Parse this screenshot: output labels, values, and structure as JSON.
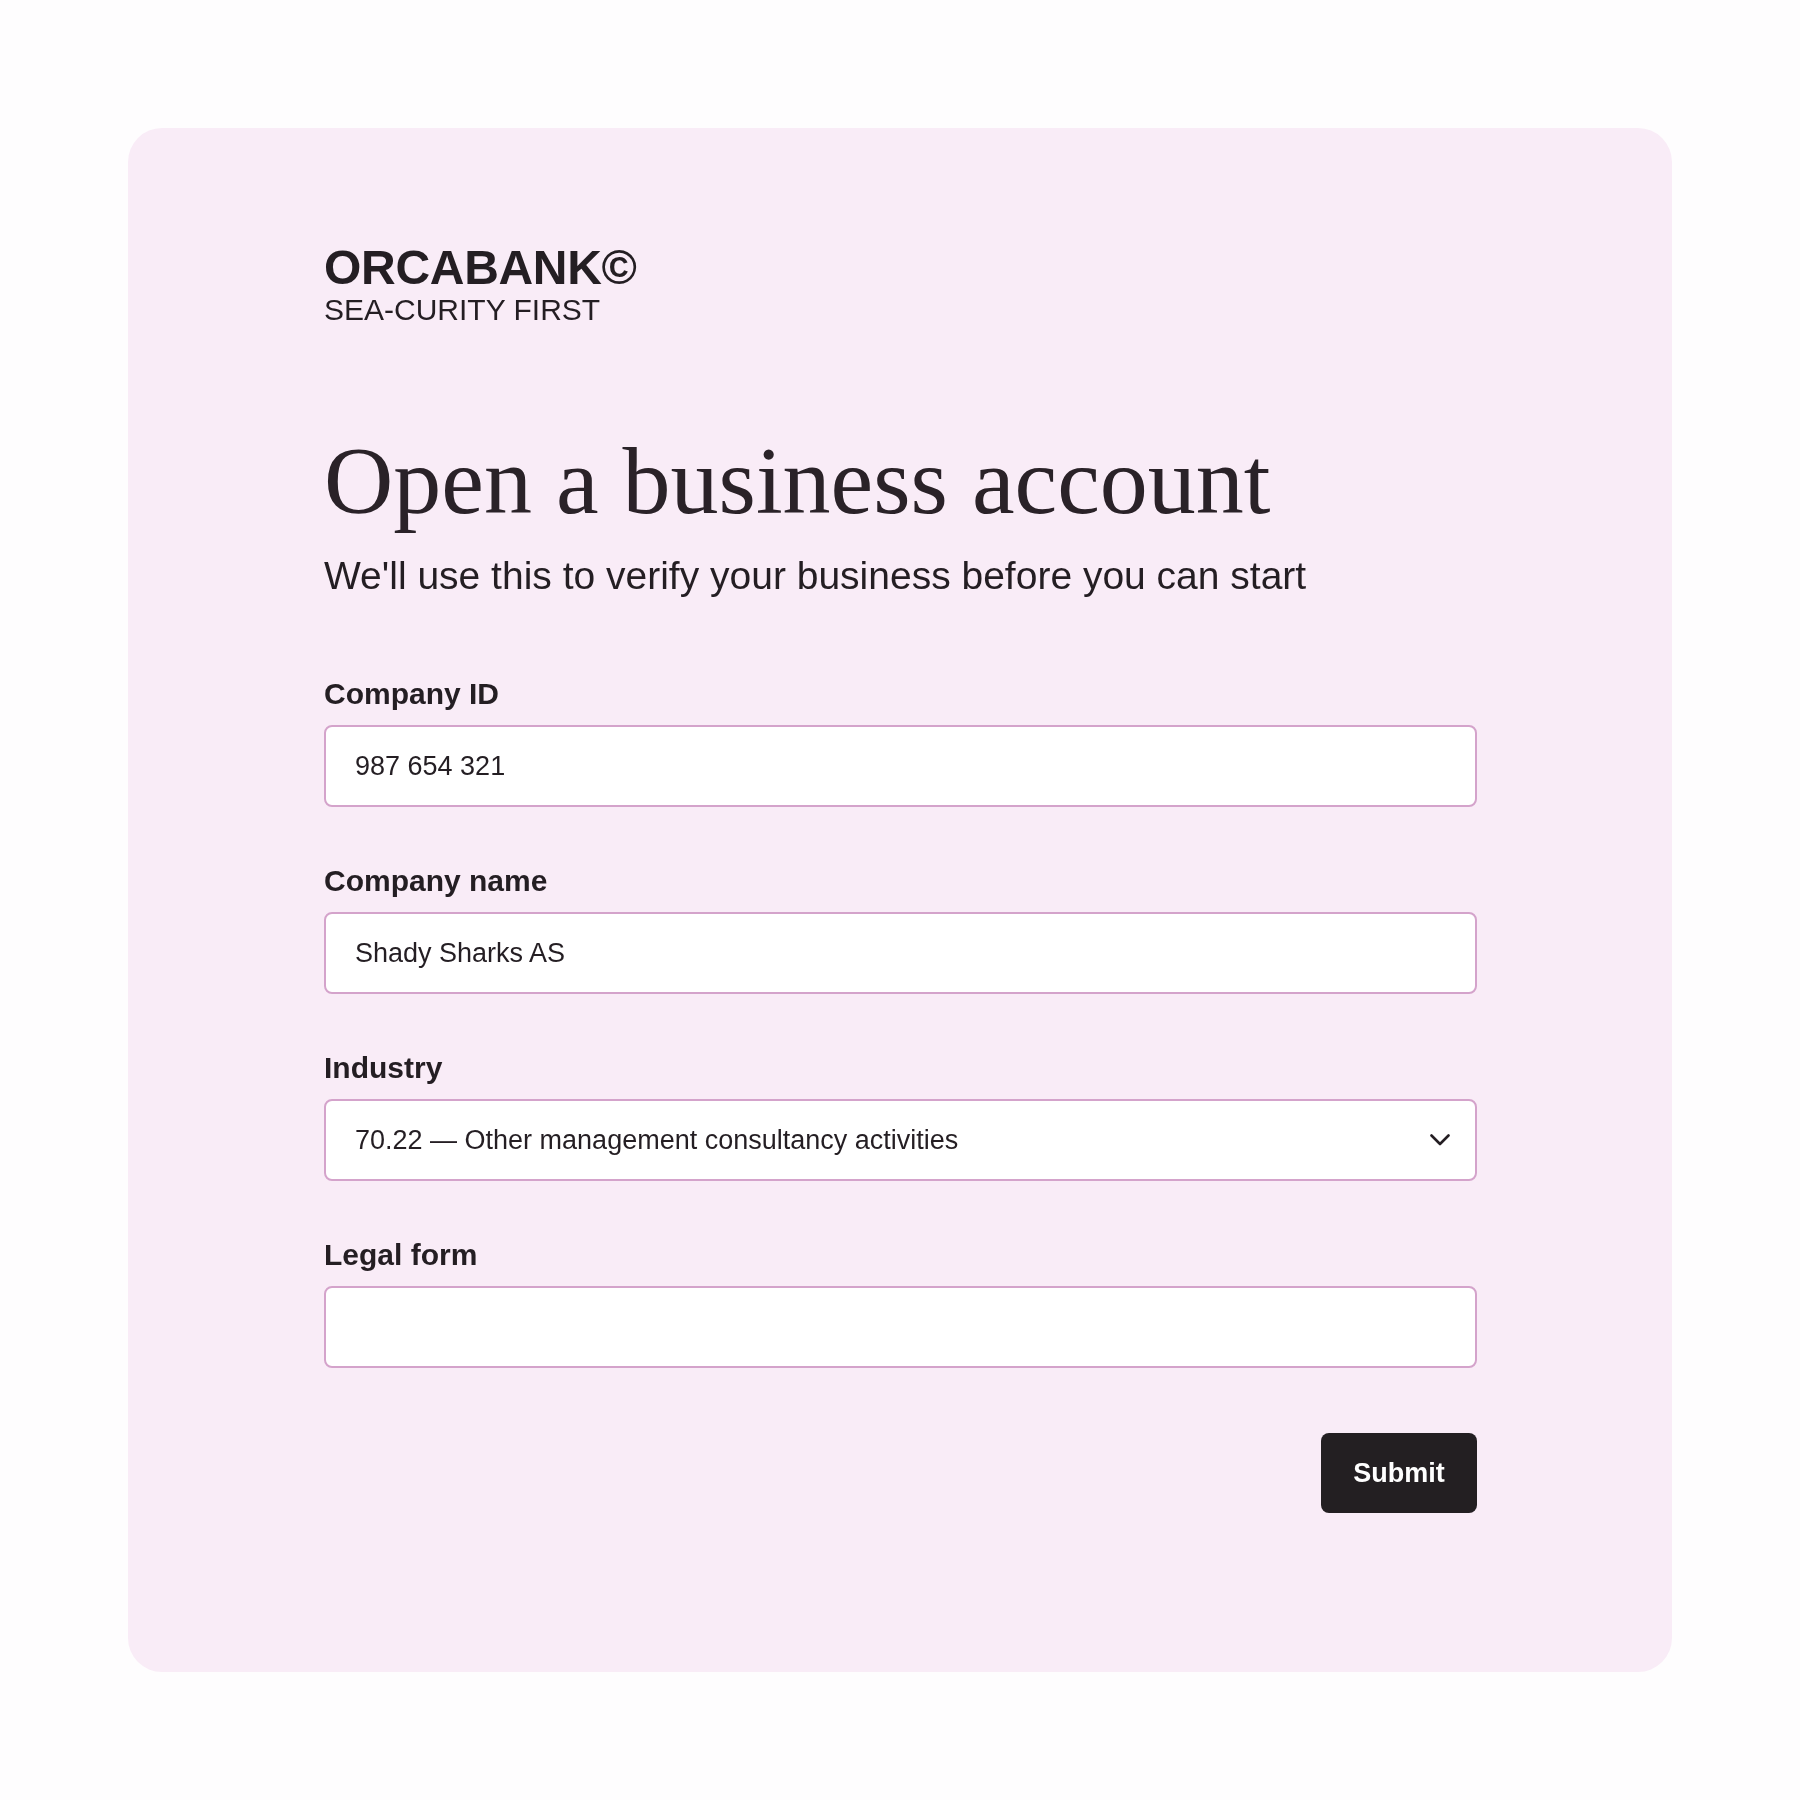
{
  "brand": {
    "name": "ORCABANK©",
    "tagline": "SEA-CURITY FIRST"
  },
  "heading": {
    "title": "Open a business account",
    "subtitle": "We'll use this to verify your business before you can start"
  },
  "fields": [
    {
      "label": "Company ID",
      "kind": "text",
      "value": "987 654 321"
    },
    {
      "label": "Company name",
      "kind": "text",
      "value": "Shady Sharks AS"
    },
    {
      "label": "Industry",
      "kind": "select",
      "value": "70.22 — Other management consultancy activities"
    },
    {
      "label": "Legal form",
      "kind": "text"
    }
  ],
  "buttons": [
    {
      "label": "Submit"
    }
  ]
}
